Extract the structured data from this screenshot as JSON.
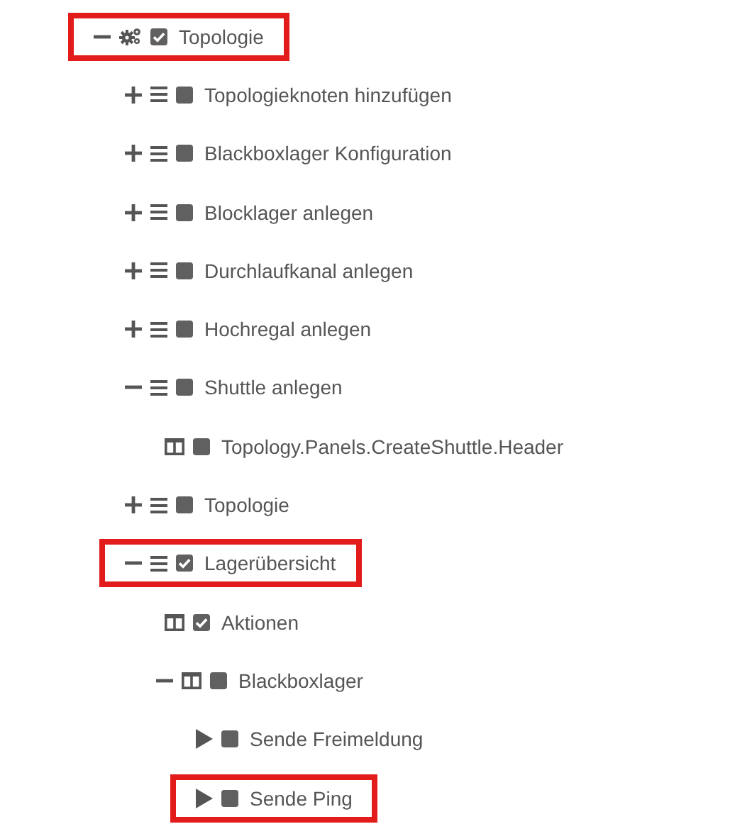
{
  "tree": [
    {
      "label": "Topologie",
      "kind": "gears",
      "checked": true,
      "expanded": true,
      "highlighted": true,
      "children": [
        {
          "label": "Topologieknoten hinzufügen",
          "kind": "list",
          "checked": false,
          "expanded": false,
          "highlighted": false
        },
        {
          "label": "Blackboxlager Konfiguration",
          "kind": "list",
          "checked": false,
          "expanded": false,
          "highlighted": false
        },
        {
          "label": "Blocklager anlegen",
          "kind": "list",
          "checked": false,
          "expanded": false,
          "highlighted": false
        },
        {
          "label": "Durchlaufkanal anlegen",
          "kind": "list",
          "checked": false,
          "expanded": false,
          "highlighted": false
        },
        {
          "label": "Hochregal anlegen",
          "kind": "list",
          "checked": false,
          "expanded": false,
          "highlighted": false
        },
        {
          "label": "Shuttle anlegen",
          "kind": "list",
          "checked": false,
          "expanded": true,
          "highlighted": false,
          "children": [
            {
              "label": "Topology.Panels.CreateShuttle.Header",
              "kind": "panel",
              "checked": false,
              "highlighted": false
            }
          ]
        },
        {
          "label": "Topologie",
          "kind": "list",
          "checked": false,
          "expanded": false,
          "highlighted": false
        },
        {
          "label": "Lagerübersicht",
          "kind": "list",
          "checked": true,
          "expanded": true,
          "highlighted": true,
          "children": [
            {
              "label": "Aktionen",
              "kind": "panel",
              "checked": true,
              "highlighted": false
            },
            {
              "label": "Blackboxlager",
              "kind": "panel",
              "checked": false,
              "expanded": true,
              "highlighted": false,
              "children": [
                {
                  "label": "Sende Freimeldung",
                  "kind": "action",
                  "checked": false,
                  "highlighted": false
                },
                {
                  "label": "Sende Ping",
                  "kind": "action",
                  "checked": false,
                  "highlighted": true
                }
              ]
            }
          ]
        }
      ]
    }
  ]
}
